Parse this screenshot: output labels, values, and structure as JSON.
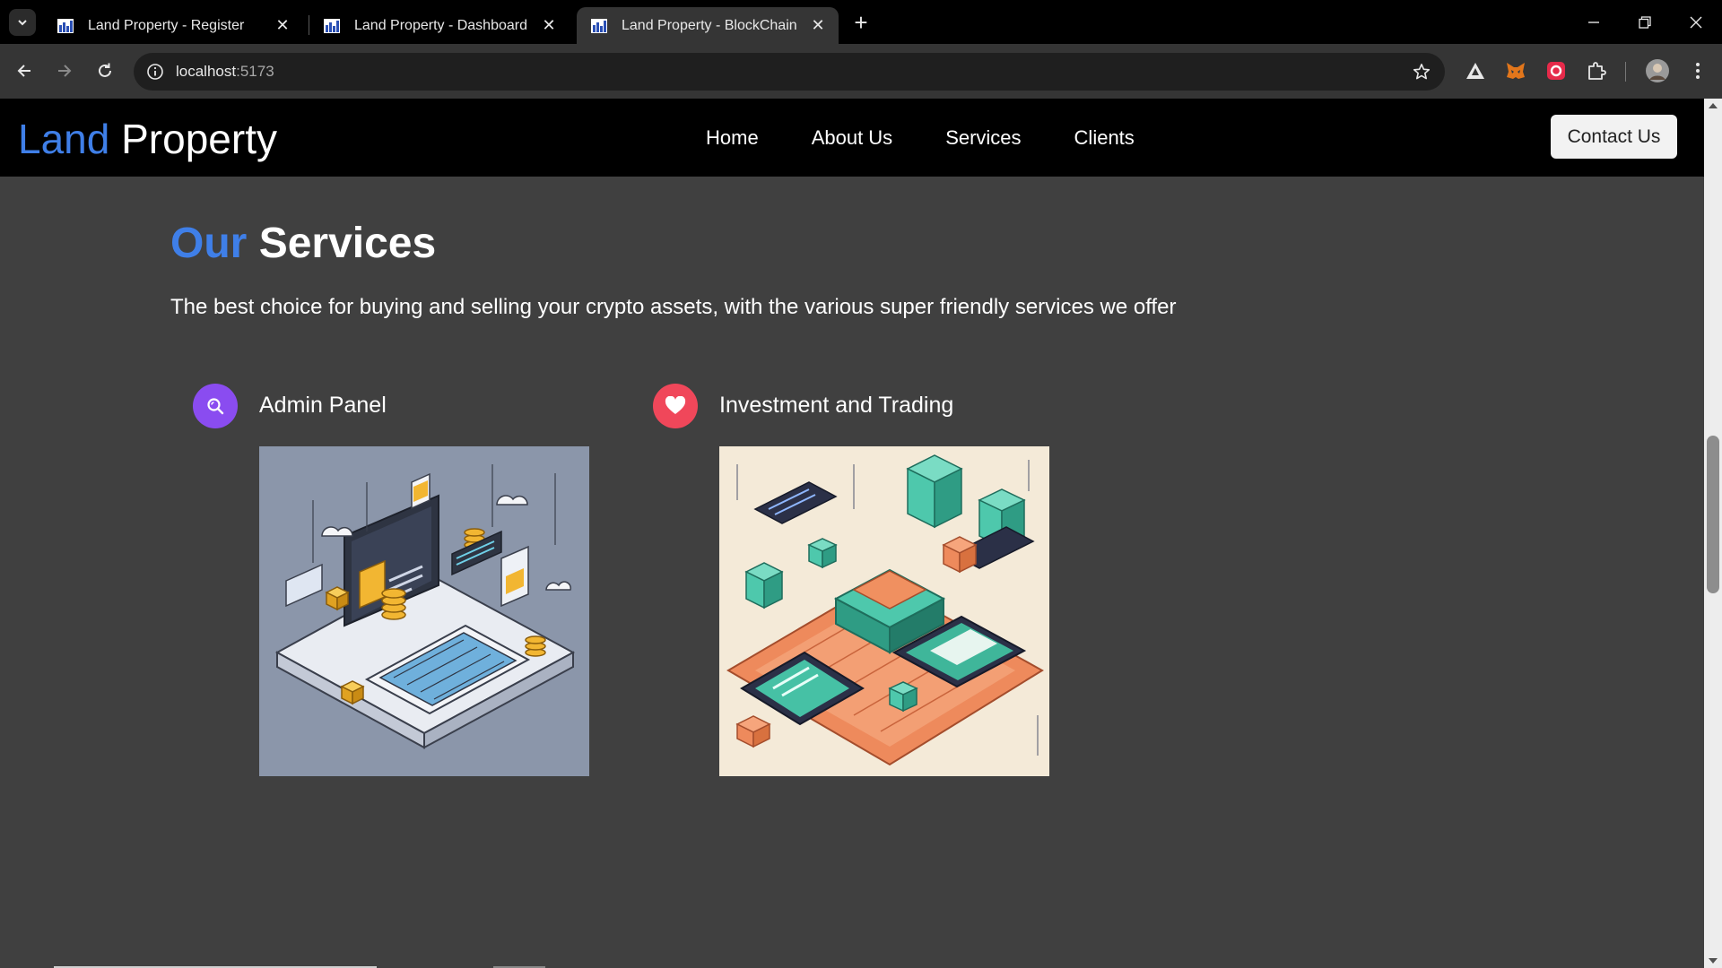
{
  "browser": {
    "tabs": [
      {
        "title": "Land Property - Register",
        "active": false
      },
      {
        "title": "Land Property - Dashboard",
        "active": false
      },
      {
        "title": "Land Property - BlockChain",
        "active": true
      }
    ],
    "url_host": "localhost",
    "url_port": ":5173"
  },
  "site": {
    "logo_accent": "Land",
    "logo_rest": "Property",
    "nav": [
      "Home",
      "About Us",
      "Services",
      "Clients"
    ],
    "contact_label": "Contact Us"
  },
  "services_section": {
    "title_accent": "Our",
    "title_rest": "Services",
    "subtitle": "The best choice for buying and selling your crypto assets, with the various super friendly services we offer",
    "items": [
      {
        "title": "Admin Panel",
        "icon": "search-icon",
        "icon_color": "#8a4cf0"
      },
      {
        "title": "Investment and Trading",
        "icon": "heart-icon",
        "icon_color": "#f0475a"
      }
    ]
  },
  "colors": {
    "accent": "#3f7fe8",
    "page_bg": "#404040",
    "nav_bg": "#000000"
  }
}
